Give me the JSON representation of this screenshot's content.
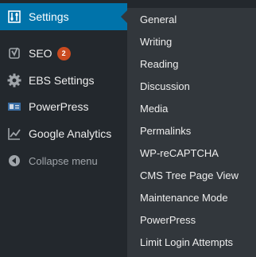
{
  "menu": {
    "settings": {
      "label": "Settings",
      "icon": "settings-sliders-icon"
    },
    "seo": {
      "label": "SEO",
      "icon": "yoast-icon",
      "badge": "2"
    },
    "ebs": {
      "label": "EBS Settings",
      "icon": "gear-icon"
    },
    "powerpress": {
      "label": "PowerPress",
      "icon": "podcast-icon"
    },
    "analytics": {
      "label": "Google Analytics",
      "icon": "analytics-chart-icon"
    },
    "collapse": {
      "label": "Collapse menu",
      "icon": "collapse-arrow-icon"
    }
  },
  "submenu": {
    "items": [
      "General",
      "Writing",
      "Reading",
      "Discussion",
      "Media",
      "Permalinks",
      "WP-reCAPTCHA",
      "CMS Tree Page View",
      "Maintenance Mode",
      "PowerPress",
      "Limit Login Attempts"
    ]
  },
  "colors": {
    "sidebar_bg": "#23282d",
    "submenu_bg": "#32373c",
    "active_bg": "#0073aa",
    "badge_bg": "#ca4a1f"
  }
}
